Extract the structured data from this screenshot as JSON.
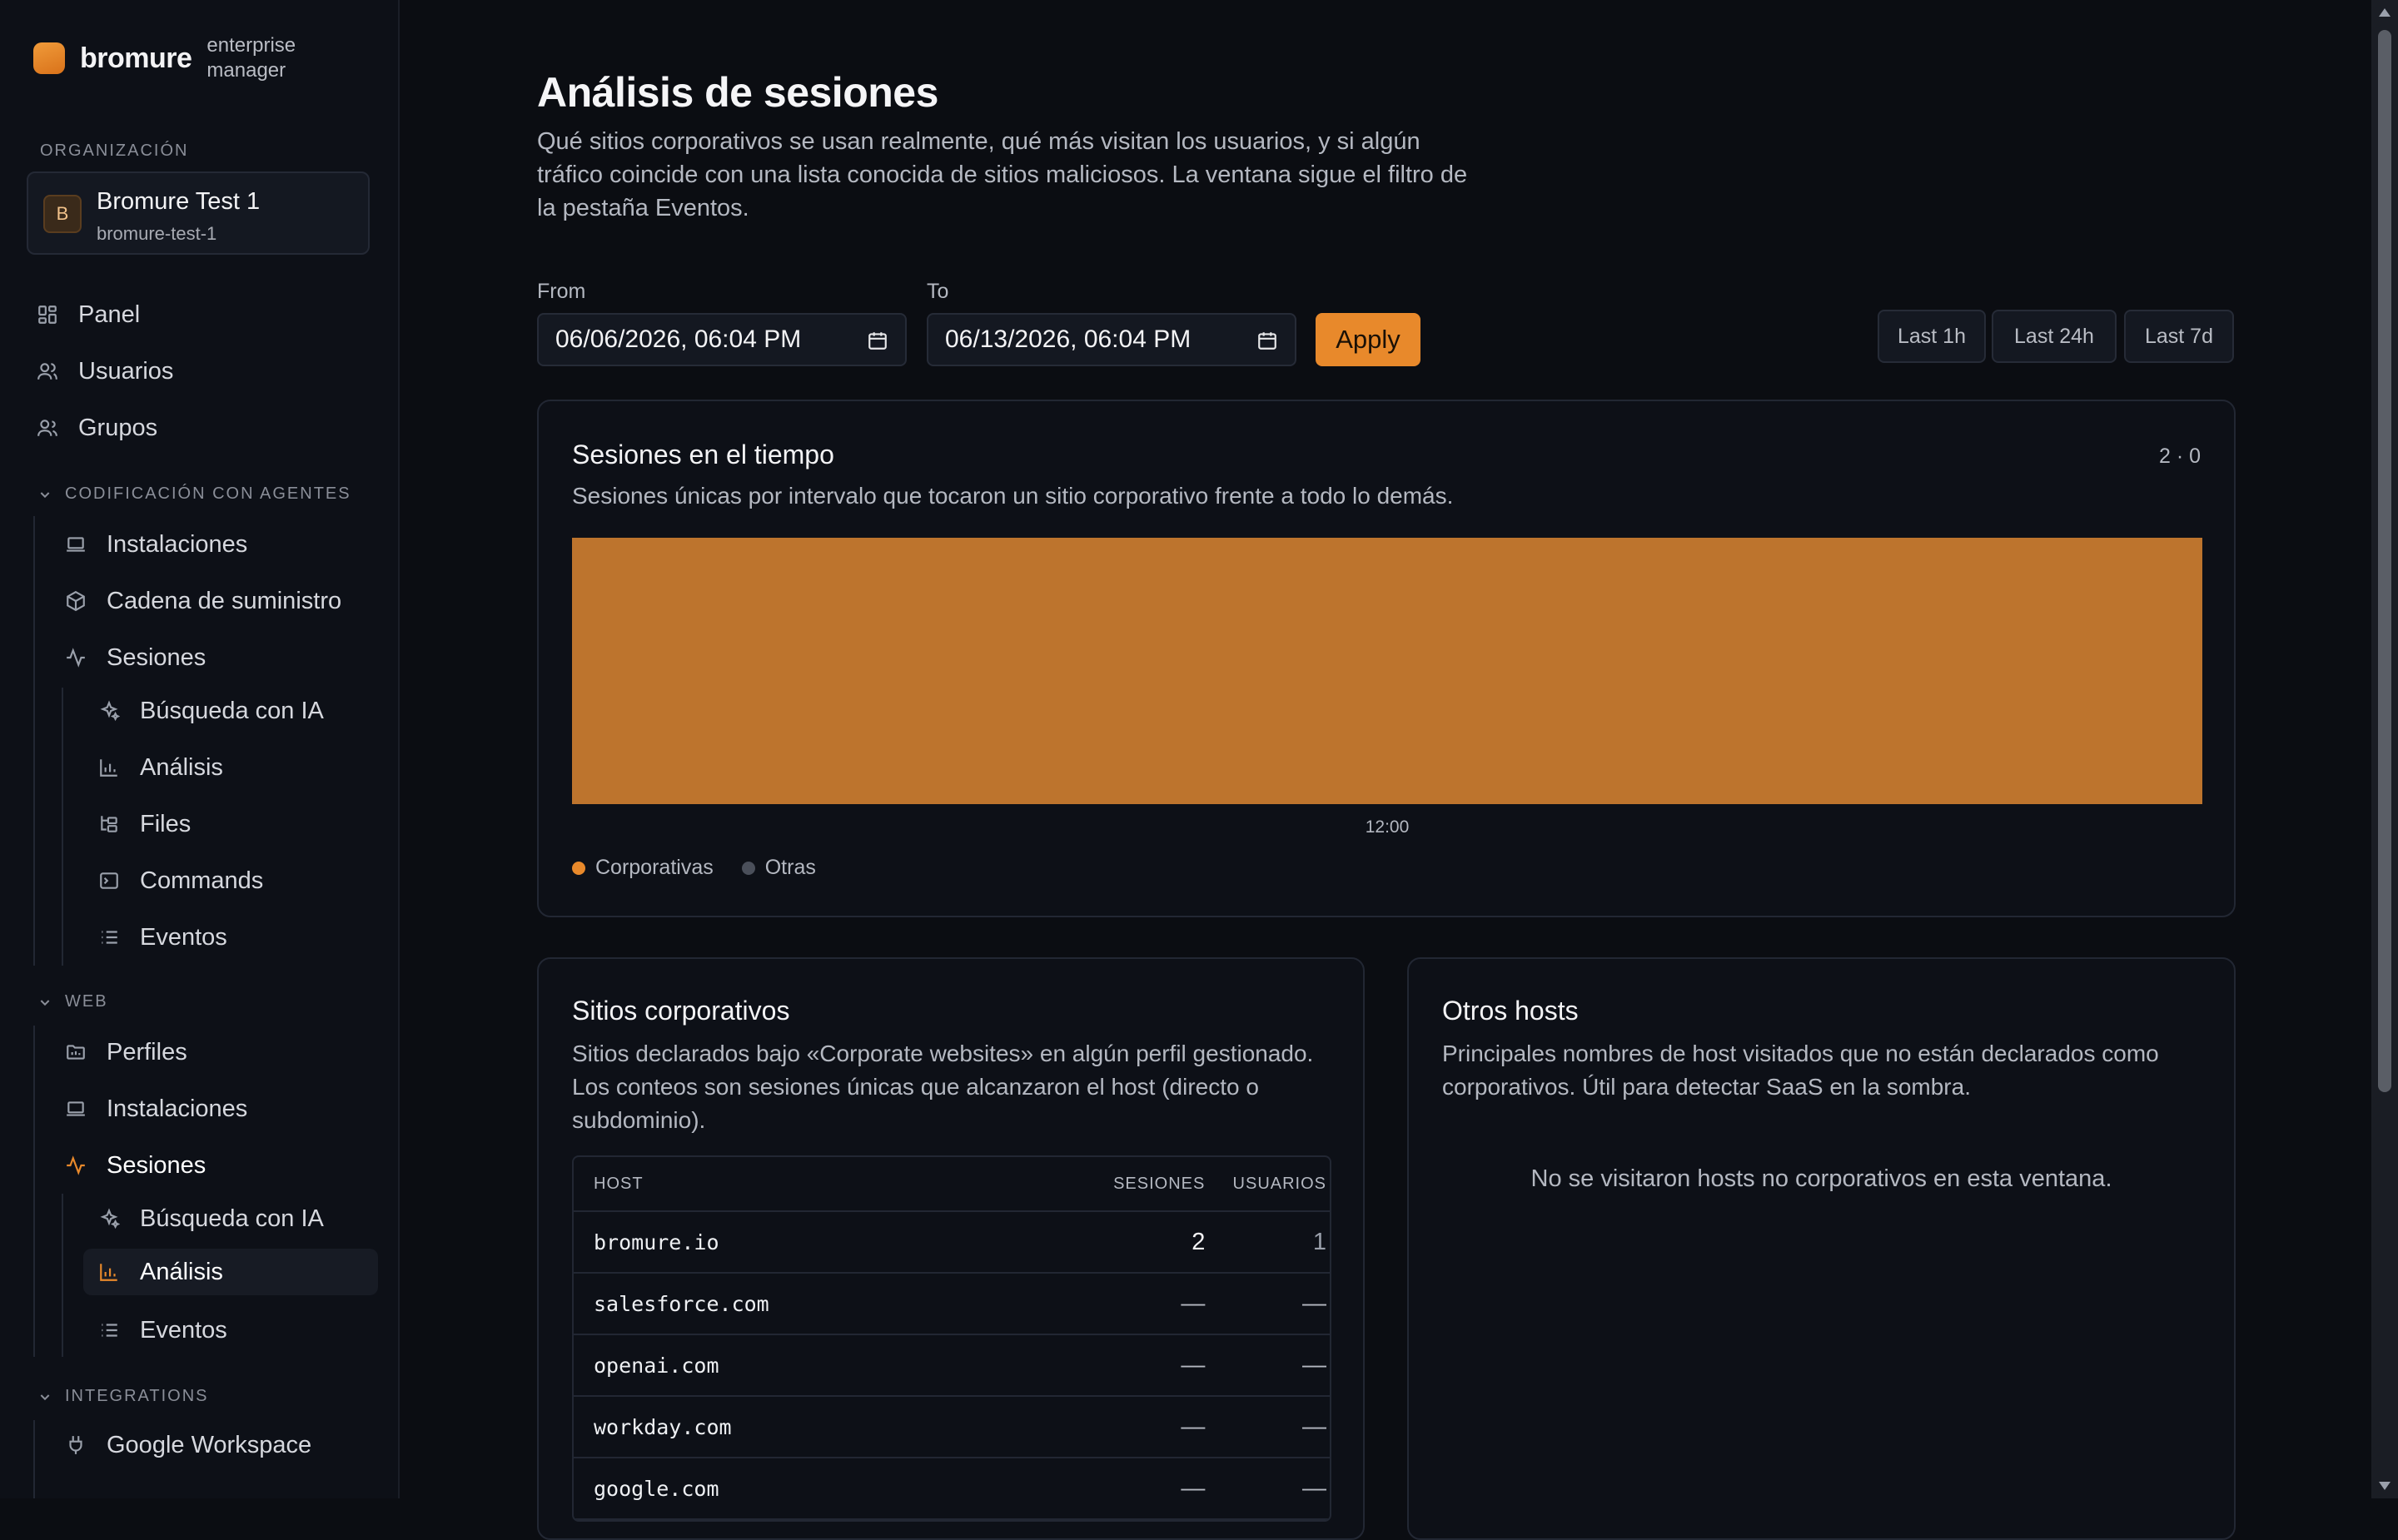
{
  "brand": {
    "name": "bromure",
    "subtitle": "enterprise manager"
  },
  "organization": {
    "section_label": "ORGANIZACIÓN",
    "avatar": "B",
    "name": "Bromure Test 1",
    "slug": "bromure-test-1"
  },
  "nav": {
    "top": [
      {
        "label": "Panel",
        "icon": "dashboard-icon"
      },
      {
        "label": "Usuarios",
        "icon": "users-icon"
      },
      {
        "label": "Grupos",
        "icon": "group-icon"
      }
    ],
    "agent_coding": {
      "label": "CODIFICACIÓN CON AGENTES",
      "items": [
        "Instalaciones",
        "Cadena de suministro",
        "Sesiones"
      ],
      "session_children": [
        "Búsqueda con IA",
        "Análisis",
        "Files",
        "Commands",
        "Eventos"
      ]
    },
    "web": {
      "label": "WEB",
      "items": [
        "Perfiles",
        "Instalaciones",
        "Sesiones"
      ],
      "session_children": [
        "Búsqueda con IA",
        "Análisis",
        "Eventos"
      ],
      "active_item": "Sesiones",
      "active_child": "Análisis"
    },
    "integrations": {
      "label": "INTEGRATIONS",
      "items": [
        "Google Workspace"
      ]
    }
  },
  "page": {
    "title": "Análisis de sesiones",
    "description": "Qué sitios corporativos se usan realmente, qué más visitan los usuarios, y si algún tráfico coincide con una lista conocida de sitios maliciosos. La ventana sigue el filtro de la pestaña Eventos."
  },
  "filters": {
    "from_label": "From",
    "from_value": "06/06/2026, 06:04 PM",
    "to_label": "To",
    "to_value": "06/13/2026, 06:04 PM",
    "apply_label": "Apply",
    "ranges": [
      "Last 1h",
      "Last 24h",
      "Last 7d"
    ]
  },
  "sessions_chart": {
    "title": "Sesiones en el tiempo",
    "counter": "2 · 0",
    "description": "Sesiones únicas por intervalo que tocaron un sitio corporativo frente a todo lo demás.",
    "legend": [
      "Corporativas",
      "Otras"
    ]
  },
  "chart_data": {
    "type": "bar",
    "categories": [
      "12:00"
    ],
    "series": [
      {
        "name": "Corporativas",
        "values": [
          2
        ]
      },
      {
        "name": "Otras",
        "values": [
          0
        ]
      }
    ],
    "colors": {
      "Corporativas": "#bd742d",
      "Otras": "#4a4f5a"
    },
    "stacked": true,
    "ylim": [
      0,
      2
    ],
    "grid": false,
    "legend_position": "bottom-left"
  },
  "corporate_sites": {
    "title": "Sitios corporativos",
    "description": "Sitios declarados bajo «Corporate websites» en algún perfil gestionado. Los conteos son sesiones únicas que alcanzaron el host (directo o subdominio).",
    "columns": [
      "HOST",
      "SESIONES",
      "USUARIOS"
    ],
    "rows": [
      {
        "host": "bromure.io",
        "sessions": "2",
        "users": "1"
      },
      {
        "host": "salesforce.com",
        "sessions": "—",
        "users": "—"
      },
      {
        "host": "openai.com",
        "sessions": "—",
        "users": "—"
      },
      {
        "host": "workday.com",
        "sessions": "—",
        "users": "—"
      },
      {
        "host": "google.com",
        "sessions": "—",
        "users": "—"
      }
    ]
  },
  "other_hosts": {
    "title": "Otros hosts",
    "description": "Principales nombres de host visitados que no están declarados como corporativos. Útil para detectar SaaS en la sombra.",
    "empty_message": "No se visitaron hosts no corporativos en esta ventana."
  },
  "colors": {
    "accent": "#e8892b",
    "background": "#0b0d12",
    "card_border": "#222733"
  }
}
